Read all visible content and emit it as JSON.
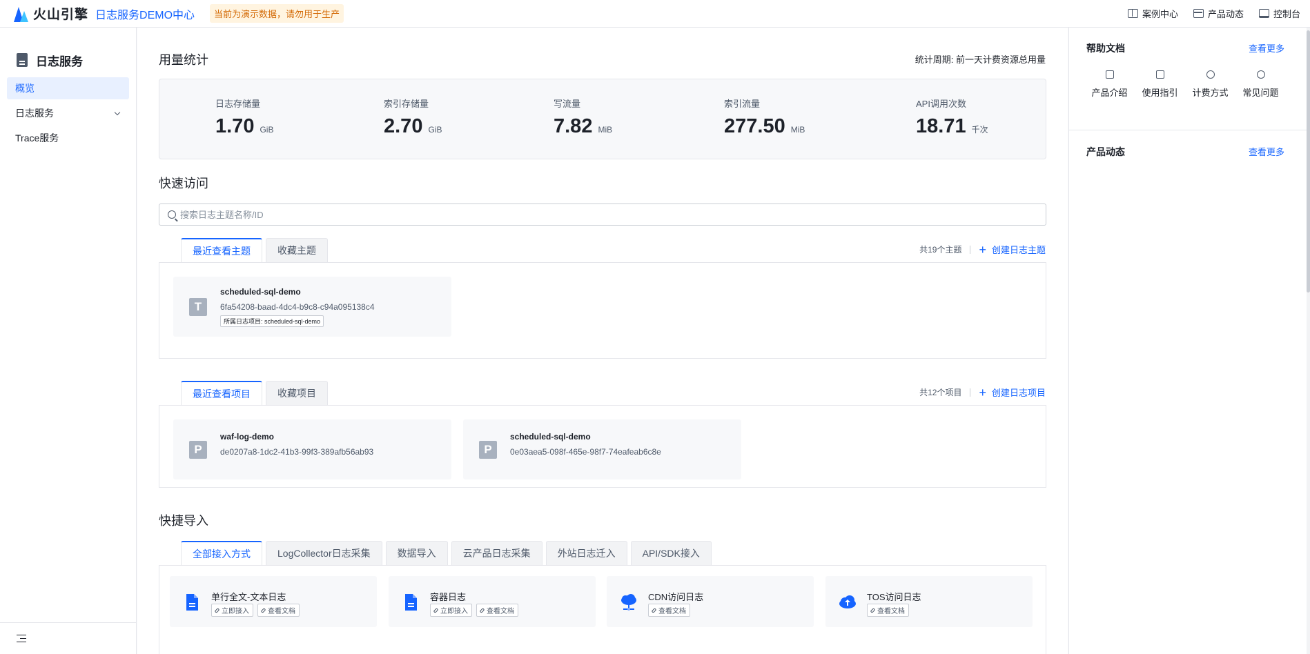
{
  "topbar": {
    "brand": "火山引擎",
    "product": "日志服务DEMO中心",
    "demo_notice": "当前为演示数据，请勿用于生产",
    "links": [
      {
        "label": "案例中心",
        "icon": "book-icon"
      },
      {
        "label": "产品动态",
        "icon": "calendar-icon"
      },
      {
        "label": "控制台",
        "icon": "monitor-icon"
      }
    ]
  },
  "sidebar": {
    "title": "日志服务",
    "items": [
      {
        "label": "概览",
        "active": true
      },
      {
        "label": "日志服务",
        "expandable": true
      },
      {
        "label": "Trace服务"
      }
    ]
  },
  "usage": {
    "title": "用量统计",
    "period": "统计周期: 前一天计费资源总用量",
    "stats": [
      {
        "label": "日志存储量",
        "value": "1.70",
        "unit": "GiB"
      },
      {
        "label": "索引存储量",
        "value": "2.70",
        "unit": "GiB"
      },
      {
        "label": "写流量",
        "value": "7.82",
        "unit": "MiB"
      },
      {
        "label": "索引流量",
        "value": "277.50",
        "unit": "MiB"
      },
      {
        "label": "API调用次数",
        "value": "18.71",
        "unit": "千次"
      }
    ]
  },
  "quick_access": {
    "title": "快速访问",
    "search_placeholder": "搜索日志主题名称/ID",
    "topics": {
      "tabs": [
        "最近查看主题",
        "收藏主题"
      ],
      "count": "共19个主题",
      "create": "创建日志主题",
      "cards": [
        {
          "letter": "T",
          "name": "scheduled-sql-demo",
          "id": "6fa54208-baad-4dc4-b9c8-c94a095138c4",
          "tag": "所属日志项目: scheduled-sql-demo"
        }
      ]
    },
    "projects": {
      "tabs": [
        "最近查看项目",
        "收藏项目"
      ],
      "count": "共12个项目",
      "create": "创建日志项目",
      "cards": [
        {
          "letter": "P",
          "name": "waf-log-demo",
          "id": "de0207a8-1dc2-41b3-99f3-389afb56ab93"
        },
        {
          "letter": "P",
          "name": "scheduled-sql-demo",
          "id": "0e03aea5-098f-465e-98f7-74eafeab6c8e"
        }
      ]
    }
  },
  "quick_import": {
    "title": "快捷导入",
    "tabs": [
      "全部接入方式",
      "LogCollector日志采集",
      "数据导入",
      "云产品日志采集",
      "外站日志迁入",
      "API/SDK接入"
    ],
    "cards": [
      {
        "title": "单行全文-文本日志",
        "icon": "file-icon",
        "buttons": [
          "立即接入",
          "查看文档"
        ]
      },
      {
        "title": "容器日志",
        "icon": "file-icon",
        "buttons": [
          "立即接入",
          "查看文档"
        ]
      },
      {
        "title": "CDN访问日志",
        "icon": "cdn-cloud-icon",
        "buttons": [
          "查看文档"
        ]
      },
      {
        "title": "TOS访问日志",
        "icon": "upload-cloud-icon",
        "buttons": [
          "查看文档"
        ]
      }
    ]
  },
  "right_panel": {
    "help": {
      "title": "帮助文档",
      "more": "查看更多",
      "links": [
        {
          "label": "产品介绍",
          "icon": "doc-icon"
        },
        {
          "label": "使用指引",
          "icon": "book-open-icon"
        },
        {
          "label": "计费方式",
          "icon": "billing-icon"
        },
        {
          "label": "常见问题",
          "icon": "question-icon"
        }
      ]
    },
    "news": {
      "title": "产品动态",
      "more": "查看更多"
    }
  },
  "colors": {
    "accent": "#1664ff",
    "notice_bg": "#fff4e0",
    "notice_text": "#d46b08"
  }
}
